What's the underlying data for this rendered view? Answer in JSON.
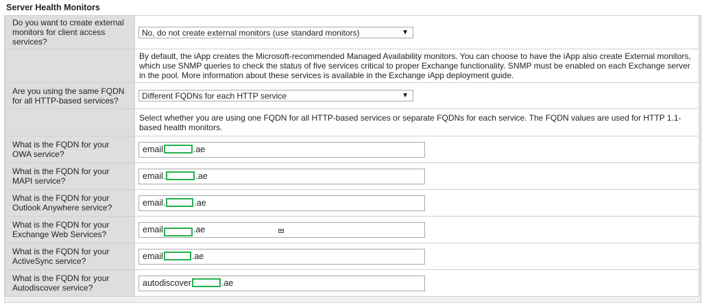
{
  "section": {
    "title": "Server Health Monitors"
  },
  "rows": {
    "create_monitors": {
      "label": "Do you want to create external monitors for client access services?",
      "value": "No, do not create external monitors (use standard monitors)"
    },
    "monitors_info": {
      "text": "By default, the iApp creates the Microsoft-recommended Managed Availability monitors. You can choose to have the iApp also create External monitors, which use SNMP queries to check the status of five services critical to proper Exchange functionality. SNMP must be enabled on each Exchange server in the pool. More information about these services is available in the Exchange iApp deployment guide."
    },
    "same_fqdn": {
      "label": "Are you using the same FQDN for all HTTP-based services?",
      "value": "Different FQDNs for each HTTP service"
    },
    "fqdn_info": {
      "text": "Select whether you are using one FQDN for all HTTP-based services or separate FQDNs for each service. The FQDN values are used for HTTP 1.1-based health monitors."
    },
    "owa": {
      "label": "What is the FQDN for your OWA service?",
      "prefix": "email",
      "suffix": ".ae"
    },
    "mapi": {
      "label": "What is the FQDN for your MAPI service?",
      "prefix": "email.",
      "suffix": ".ae"
    },
    "outlook_anywhere": {
      "label": "What is the FQDN for your Outlook Anywhere service?",
      "prefix": "email.",
      "suffix": ".ae"
    },
    "ews": {
      "label": "What is the FQDN for your Exchange Web Services?",
      "prefix": "email",
      "suffix": ".ae"
    },
    "activesync": {
      "label": "What is the FQDN for your ActiveSync service?",
      "prefix": "email",
      "suffix": ".ae"
    },
    "autodiscover": {
      "label": "What is the FQDN for your Autodiscover service?",
      "prefix": "autodiscover",
      "suffix": ".ae"
    }
  },
  "icons": {
    "dropdown": "chevron-down-icon",
    "redaction": "redaction-box"
  },
  "colors": {
    "label_bg": "#dedede",
    "redaction_border": "#22b14c"
  }
}
